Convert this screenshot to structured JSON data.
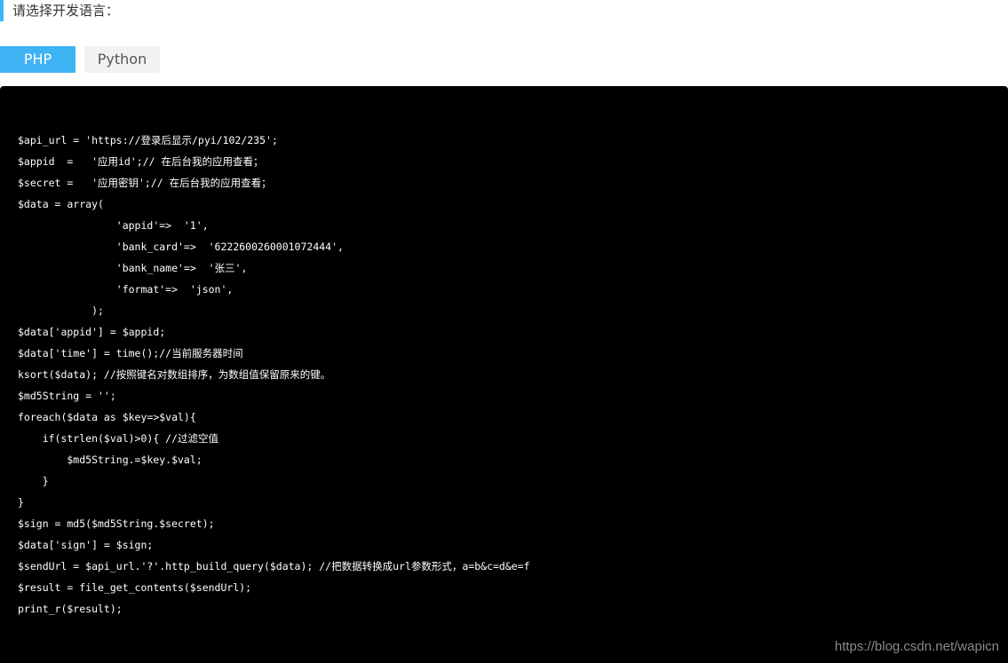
{
  "heading": "请选择开发语言：",
  "tabs": [
    {
      "label": "PHP",
      "active": true
    },
    {
      "label": "Python",
      "active": false
    }
  ],
  "accent_color": "#3fb4f5",
  "code": {
    "lines": [
      "$api_url = 'https://登录后显示/pyi/102/235';",
      "$appid  =   '应用id';// 在后台我的应用查看；",
      "$secret =   '应用密钥';// 在后台我的应用查看；",
      "$data = array(",
      "                'appid'=>  '1',",
      "                'bank_card'=>  '6222600260001072444',",
      "                'bank_name'=>  '张三',",
      "                'format'=>  'json',",
      "            );",
      "$data['appid'] = $appid;",
      "$data['time'] = time();//当前服务器时间",
      "ksort($data); //按照键名对数组排序，为数组值保留原来的键。",
      "$md5String = '';",
      "foreach($data as $key=>$val){",
      "    if(strlen($val)>0){ //过滤空值",
      "        $md5String.=$key.$val;",
      "    }",
      "}",
      "$sign = md5($md5String.$secret);",
      "$data['sign'] = $sign;",
      "$sendUrl = $api_url.'?'.http_build_query($data); //把数据转换成url参数形式，a=b&c=d&e=f",
      "$result = file_get_contents($sendUrl);",
      "print_r($result);"
    ]
  },
  "watermark": "https://blog.csdn.net/wapicn"
}
